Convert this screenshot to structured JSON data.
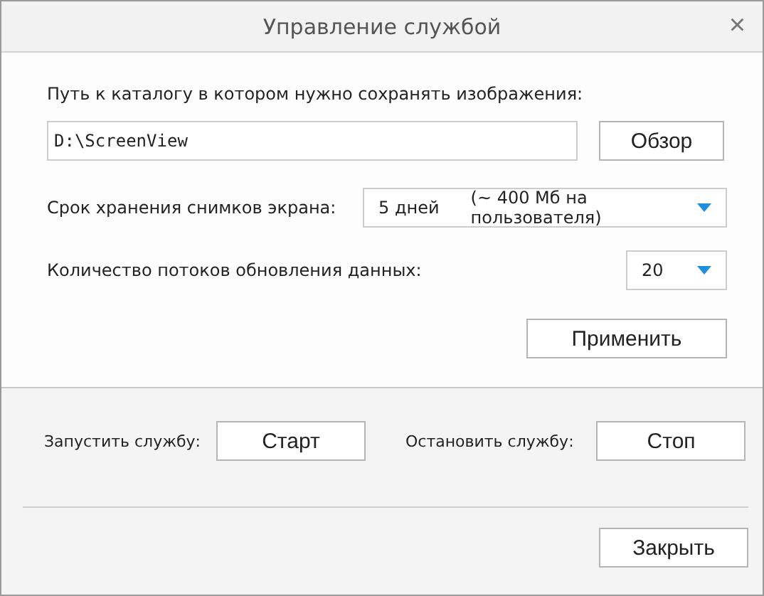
{
  "window": {
    "title": "Управление службой",
    "close": "×"
  },
  "path": {
    "label": "Путь к каталогу в котором нужно сохранять изображения:",
    "value": "D:\\ScreenView",
    "browse": "Обзор"
  },
  "retention": {
    "label": "Срок хранения снимков экрана:",
    "value": "5 дней",
    "note": "(~ 400 Мб на пользователя)"
  },
  "threads": {
    "label": "Количество потоков обновления данных:",
    "value": "20"
  },
  "apply": "Применить",
  "service": {
    "start_label": "Запустить службу:",
    "start": "Старт",
    "stop_label": "Остановить службу:",
    "stop": "Стоп"
  },
  "close_button": "Закрыть"
}
